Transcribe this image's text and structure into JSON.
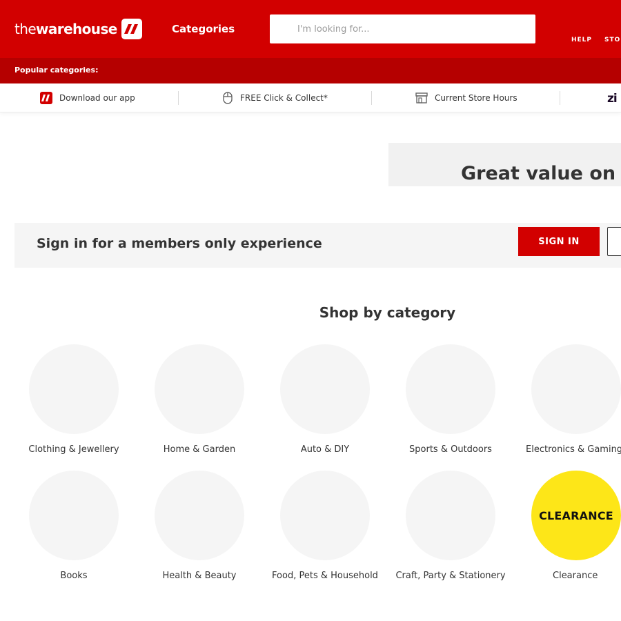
{
  "header": {
    "logo_the": "the",
    "logo_warehouse": "warehouse",
    "categories_label": "Categories",
    "search_placeholder": "I'm looking for...",
    "help_label": "HELP",
    "stores_label": "STOR"
  },
  "popular": {
    "label": "Popular categories:"
  },
  "utility": {
    "items": [
      {
        "label": "Download our app",
        "icon": "app-logo-icon"
      },
      {
        "label": "FREE Click & Collect*",
        "icon": "mouse-icon"
      },
      {
        "label": "Current Store Hours",
        "icon": "store-icon"
      }
    ],
    "zip_partial": "zi"
  },
  "banner": {
    "text": "Great value on gr"
  },
  "signin": {
    "text": "Sign in for a members only experience",
    "button_label": "SIGN IN"
  },
  "shop": {
    "title": "Shop by category",
    "categories": [
      {
        "label": "Clothing & Jewellery"
      },
      {
        "label": "Home & Garden"
      },
      {
        "label": "Auto & DIY"
      },
      {
        "label": "Sports & Outdoors"
      },
      {
        "label": "Electronics & Gaming"
      },
      {
        "label": "Books"
      },
      {
        "label": "Health & Beauty"
      },
      {
        "label": "Food, Pets & Household"
      },
      {
        "label": "Craft, Party & Stationery"
      },
      {
        "label": "Clearance",
        "badge": "CLEARANCE"
      }
    ]
  },
  "colors": {
    "brand_red": "#d20000",
    "dark_red": "#b50000",
    "clearance_yellow": "#fde618"
  }
}
